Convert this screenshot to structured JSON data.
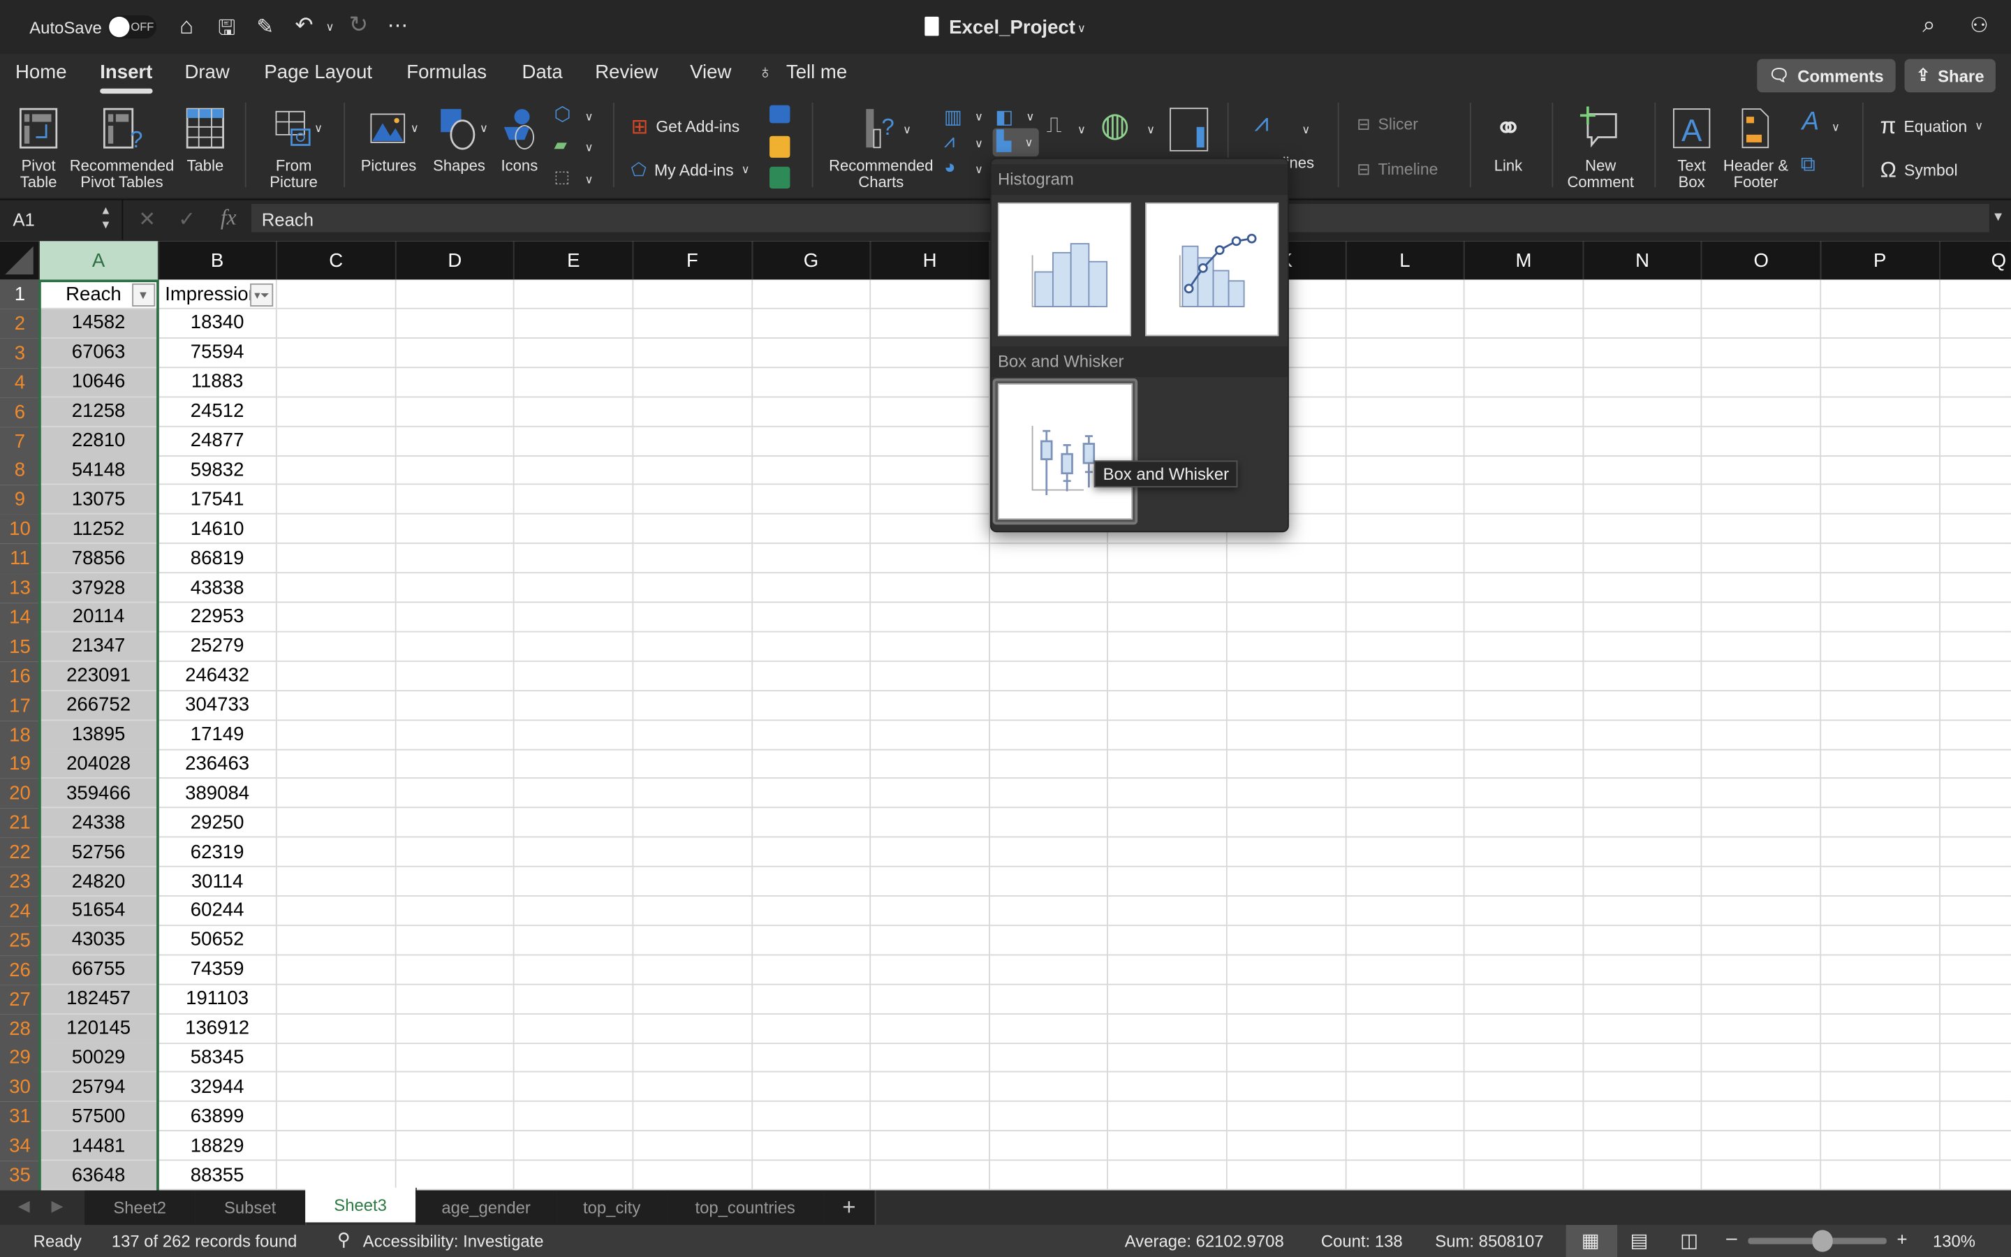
{
  "titlebar": {
    "autosave_label": "AutoSave",
    "autosave_state": "OFF",
    "doc_title": "Excel_Project"
  },
  "menu_tabs": [
    "Home",
    "Insert",
    "Draw",
    "Page Layout",
    "Formulas",
    "Data",
    "Review",
    "View"
  ],
  "active_tab": "Insert",
  "tell_me": "Tell me",
  "buttons": {
    "comments": "Comments",
    "share": "Share"
  },
  "ribbon": {
    "pivot_table": [
      "Pivot",
      "Table"
    ],
    "rec_pivot": [
      "Recommended",
      "Pivot Tables"
    ],
    "table": "Table",
    "from_picture": [
      "From",
      "Picture"
    ],
    "pictures": "Pictures",
    "shapes": "Shapes",
    "icons": "Icons",
    "get_addins": "Get Add-ins",
    "my_addins": "My Add-ins",
    "rec_charts": [
      "Recommended",
      "Charts"
    ],
    "sparklines": "lines",
    "slicer": "Slicer",
    "timeline": "Timeline",
    "link": "Link",
    "new_comment": [
      "New",
      "Comment"
    ],
    "text_box": [
      "Text",
      "Box"
    ],
    "header_footer": [
      "Header &",
      "Footer"
    ],
    "equation": "Equation",
    "symbol": "Symbol"
  },
  "formula_bar": {
    "name_box": "A1",
    "fx": "fx",
    "value": "Reach"
  },
  "columns": [
    "A",
    "B",
    "C",
    "D",
    "E",
    "F",
    "G",
    "H",
    "I",
    "J",
    "K",
    "L",
    "M",
    "N",
    "O",
    "P",
    "Q"
  ],
  "selected_column": "A",
  "header_row": {
    "row": "1",
    "a": "Reach",
    "b": "Impressions"
  },
  "rows": [
    [
      "2",
      "14582",
      "18340"
    ],
    [
      "3",
      "67063",
      "75594"
    ],
    [
      "4",
      "10646",
      "11883"
    ],
    [
      "6",
      "21258",
      "24512"
    ],
    [
      "7",
      "22810",
      "24877"
    ],
    [
      "8",
      "54148",
      "59832"
    ],
    [
      "9",
      "13075",
      "17541"
    ],
    [
      "10",
      "11252",
      "14610"
    ],
    [
      "11",
      "78856",
      "86819"
    ],
    [
      "13",
      "37928",
      "43838"
    ],
    [
      "14",
      "20114",
      "22953"
    ],
    [
      "15",
      "21347",
      "25279"
    ],
    [
      "16",
      "223091",
      "246432"
    ],
    [
      "17",
      "266752",
      "304733"
    ],
    [
      "18",
      "13895",
      "17149"
    ],
    [
      "19",
      "204028",
      "236463"
    ],
    [
      "20",
      "359466",
      "389084"
    ],
    [
      "21",
      "24338",
      "29250"
    ],
    [
      "22",
      "52756",
      "62319"
    ],
    [
      "23",
      "24820",
      "30114"
    ],
    [
      "24",
      "51654",
      "60244"
    ],
    [
      "25",
      "43035",
      "50652"
    ],
    [
      "26",
      "66755",
      "74359"
    ],
    [
      "27",
      "182457",
      "191103"
    ],
    [
      "28",
      "120145",
      "136912"
    ],
    [
      "29",
      "50029",
      "58345"
    ],
    [
      "30",
      "25794",
      "32944"
    ],
    [
      "31",
      "57500",
      "63899"
    ],
    [
      "34",
      "14481",
      "18829"
    ],
    [
      "35",
      "63648",
      "88355"
    ]
  ],
  "chart_menu": {
    "histogram_heading": "Histogram",
    "box_heading": "Box and Whisker",
    "tooltip": "Box and Whisker"
  },
  "sheets": [
    "Sheet2",
    "Subset",
    "Sheet3",
    "age_gender",
    "top_city",
    "top_countries"
  ],
  "active_sheet": "Sheet3",
  "status": {
    "ready": "Ready",
    "records": "137 of 262 records found",
    "accessibility": "Accessibility: Investigate",
    "average": "Average: 62102.9708",
    "count": "Count: 138",
    "sum": "Sum: 8508107",
    "zoom": "130%"
  },
  "colors": {
    "accent_green": "#2e7a43",
    "row_number_orange": "#f08a2c",
    "selected_header": "#bfdcc8"
  }
}
